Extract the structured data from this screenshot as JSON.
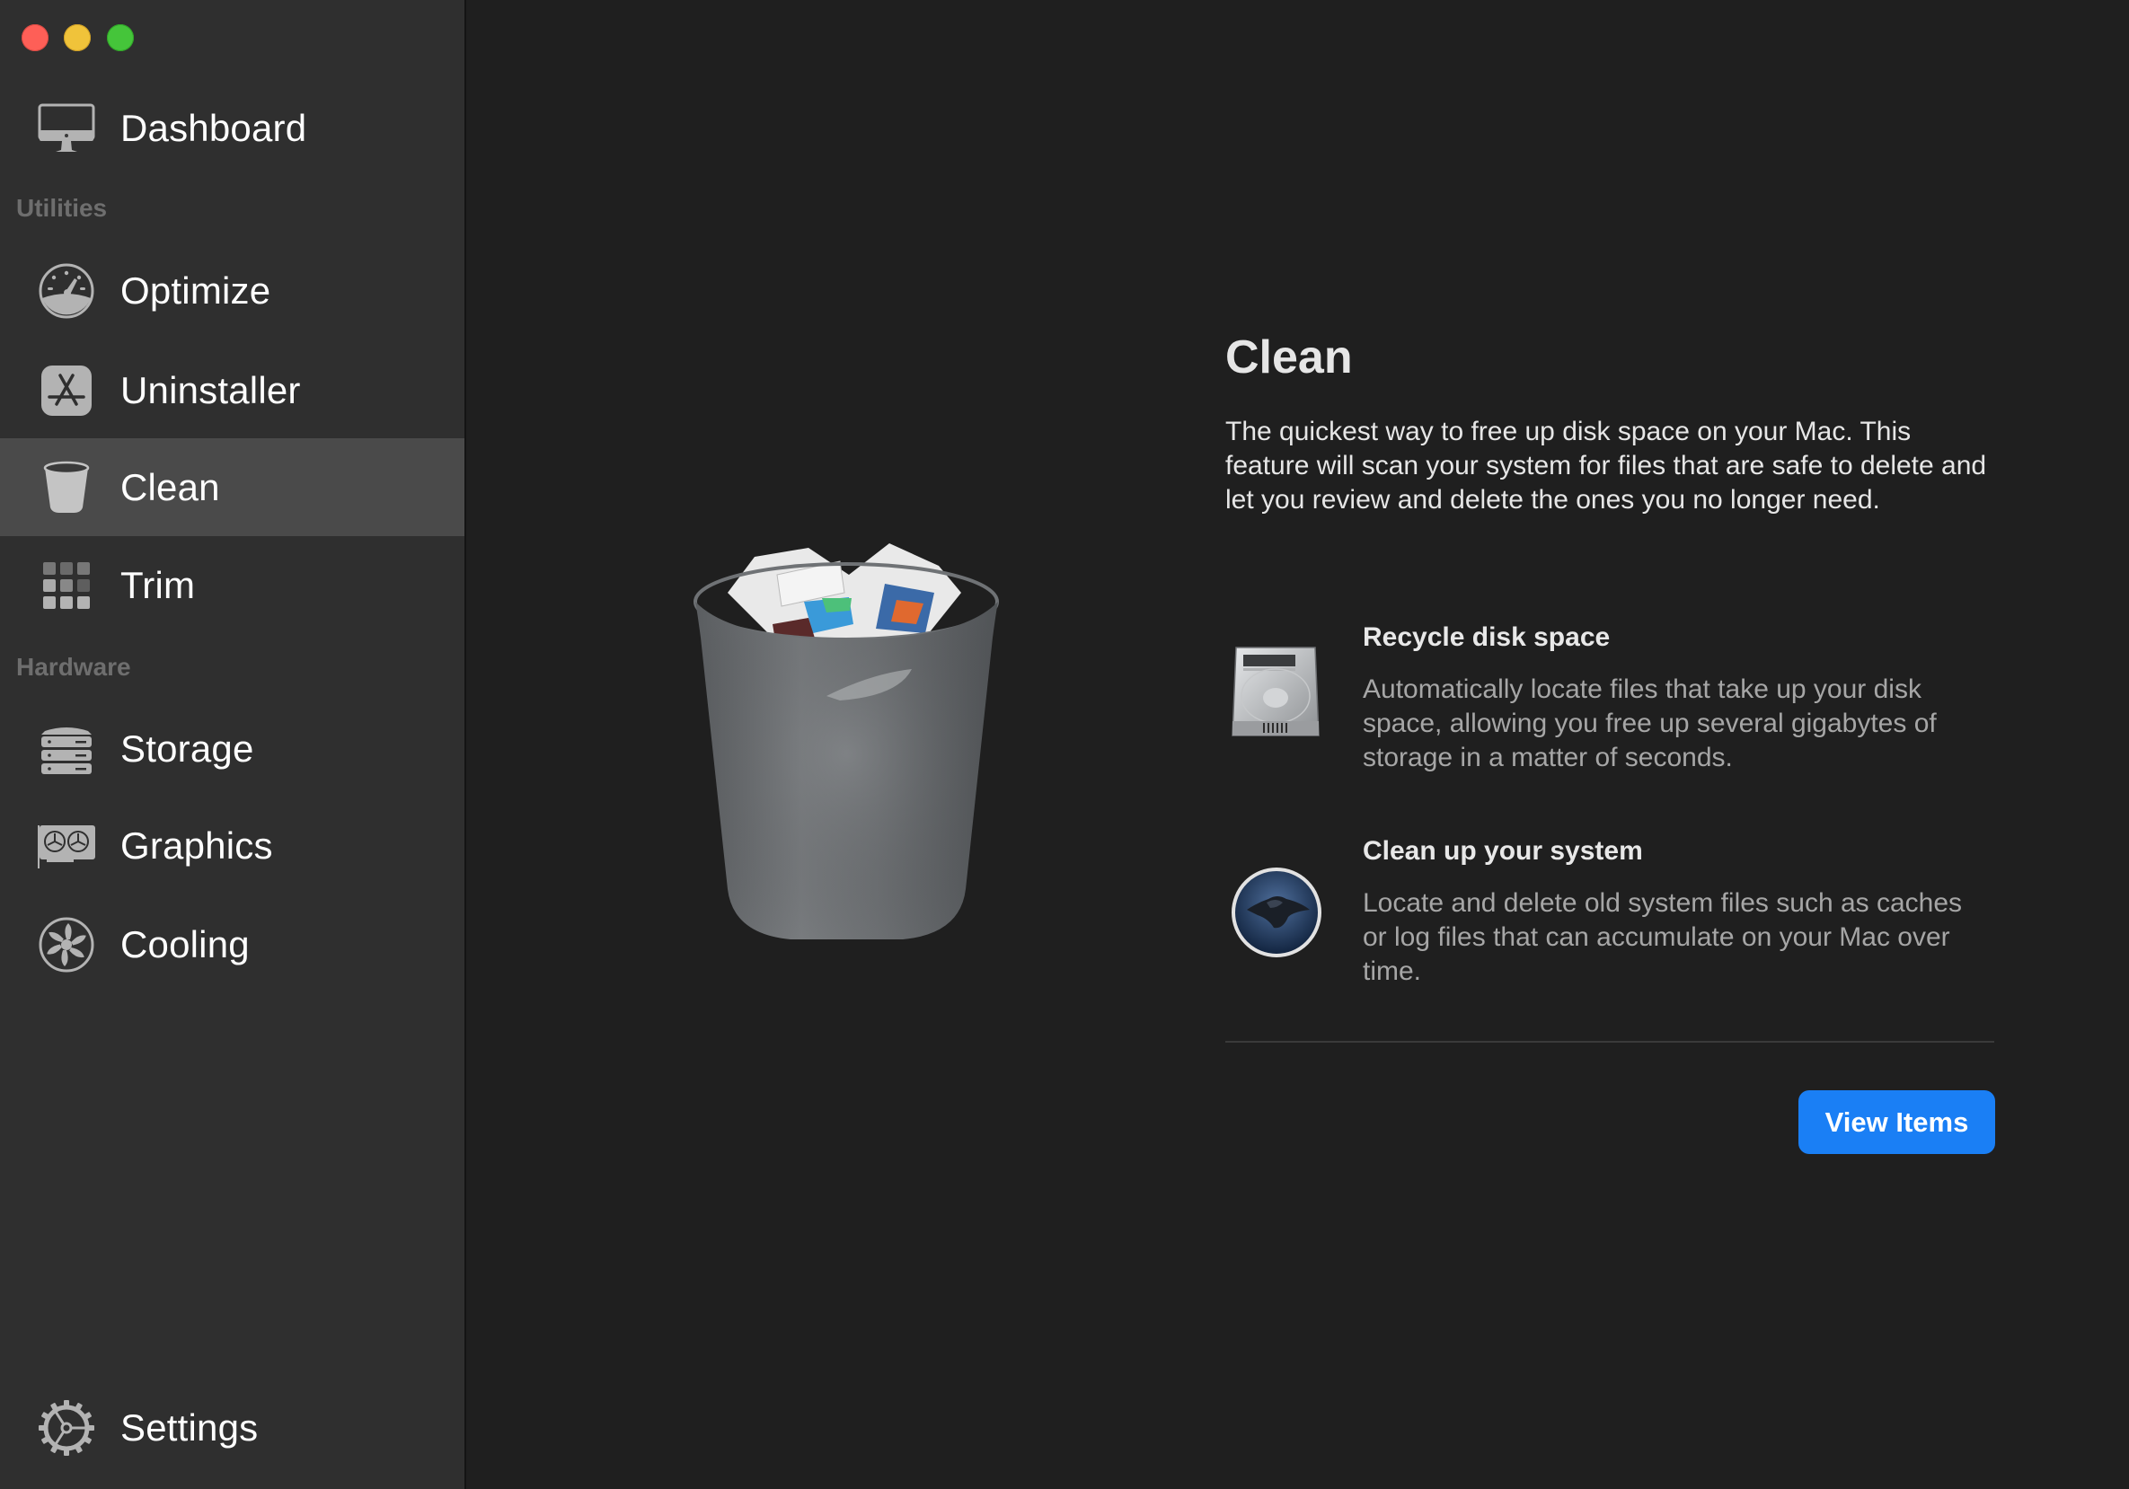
{
  "window": {
    "controls": [
      "close",
      "minimize",
      "maximize"
    ],
    "colors": {
      "close": "#fe5f57",
      "minimize": "#f0c33a",
      "maximize": "#45c53a"
    }
  },
  "sidebar": {
    "dashboard": {
      "label": "Dashboard",
      "icon": "monitor-icon"
    },
    "sections": [
      {
        "title": "Utilities",
        "items": [
          {
            "label": "Optimize",
            "icon": "speedometer-icon"
          },
          {
            "label": "Uninstaller",
            "icon": "app-store-icon"
          },
          {
            "label": "Clean",
            "icon": "trash-bin-icon",
            "selected": true
          },
          {
            "label": "Trim",
            "icon": "grid-icon"
          }
        ]
      },
      {
        "title": "Hardware",
        "items": [
          {
            "label": "Storage",
            "icon": "server-stack-icon"
          },
          {
            "label": "Graphics",
            "icon": "graphics-card-icon"
          },
          {
            "label": "Cooling",
            "icon": "fan-icon"
          }
        ]
      }
    ],
    "settings": {
      "label": "Settings",
      "icon": "gear-icon"
    },
    "selected_bg": "#4a4a4a"
  },
  "main": {
    "hero_icon": "full-trash-can-icon",
    "title": "Clean",
    "intro": "The quickest way to free up disk space on your Mac. This feature will scan your system for files that are safe to delete and let you review and delete the ones you no longer need.",
    "features": [
      {
        "icon": "hard-drive-icon",
        "title": "Recycle disk space",
        "description": "Automatically locate files that take up your disk space, allowing you free up several gigabytes of storage in a matter of seconds."
      },
      {
        "icon": "macos-catalina-icon",
        "title": "Clean up your system",
        "description": "Locate and delete old system files such as caches or log files that can accumulate on your Mac over time."
      }
    ],
    "primary_button": {
      "label": "View Items",
      "color": "#1a7ff5"
    }
  }
}
